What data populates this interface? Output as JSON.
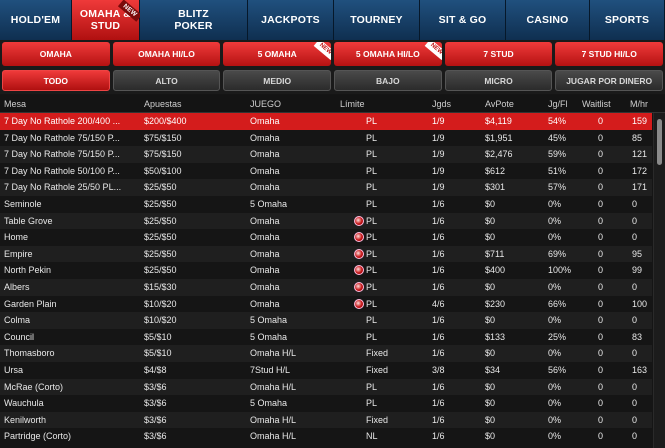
{
  "top_nav": [
    {
      "label": "HOLD'EM",
      "width": 72,
      "active": false,
      "new": false
    },
    {
      "label": "OMAHA & STUD",
      "width": 68,
      "active": true,
      "new": true
    },
    {
      "label": "BLITZ POKER",
      "width": 108,
      "active": false,
      "new": false
    },
    {
      "label": "JACKPOTS",
      "width": 86,
      "active": false,
      "new": false
    },
    {
      "label": "TOURNEY",
      "width": 86,
      "active": false,
      "new": false
    },
    {
      "label": "SIT & GO",
      "width": 86,
      "active": false,
      "new": false
    },
    {
      "label": "CASINO",
      "width": 84,
      "active": false,
      "new": false
    },
    {
      "label": "SPORTS",
      "width": 75,
      "active": false,
      "new": false
    }
  ],
  "new_badge": "NEW",
  "game_tabs": [
    {
      "label": "OMAHA",
      "new": false
    },
    {
      "label": "OMAHA HI/LO",
      "new": false
    },
    {
      "label": "5 OMAHA",
      "new": true
    },
    {
      "label": "5 OMAHA HI/LO",
      "new": true
    },
    {
      "label": "7 STUD",
      "new": false
    },
    {
      "label": "7 STUD HI/LO",
      "new": false
    }
  ],
  "filter_tabs": [
    {
      "label": "TODO",
      "active": true
    },
    {
      "label": "ALTO",
      "active": false
    },
    {
      "label": "MEDIO",
      "active": false
    },
    {
      "label": "BAJO",
      "active": false
    },
    {
      "label": "MICRO",
      "active": false
    },
    {
      "label": "JUGAR POR DINERO",
      "active": false
    }
  ],
  "columns": {
    "mesa": "Mesa",
    "apuestas": "Apuestas",
    "juego": "JUEGO",
    "limite": "Límite",
    "jgds": "Jgds",
    "avpote": "AvPote",
    "jgfl": "Jg/Fl",
    "waitlist": "Waitlist",
    "mhr": "M/hr"
  },
  "rows": [
    {
      "mesa": "7 Day No Rathole 200/400 ...",
      "apuestas": "$200/$400",
      "juego": "Omaha",
      "limite": "PL",
      "jgds": "1/9",
      "avpote": "$4,119",
      "jgfl": "54%",
      "waitlist": "0",
      "mhr": "159",
      "selected": true,
      "mark": false
    },
    {
      "mesa": "7 Day No Rathole 75/150 P...",
      "apuestas": "$75/$150",
      "juego": "Omaha",
      "limite": "PL",
      "jgds": "1/9",
      "avpote": "$1,951",
      "jgfl": "45%",
      "waitlist": "0",
      "mhr": "85",
      "selected": false,
      "mark": false
    },
    {
      "mesa": "7 Day No Rathole 75/150 P...",
      "apuestas": "$75/$150",
      "juego": "Omaha",
      "limite": "PL",
      "jgds": "1/9",
      "avpote": "$2,476",
      "jgfl": "59%",
      "waitlist": "0",
      "mhr": "121",
      "selected": false,
      "mark": false
    },
    {
      "mesa": "7 Day No Rathole 50/100 P...",
      "apuestas": "$50/$100",
      "juego": "Omaha",
      "limite": "PL",
      "jgds": "1/9",
      "avpote": "$612",
      "jgfl": "51%",
      "waitlist": "0",
      "mhr": "172",
      "selected": false,
      "mark": false
    },
    {
      "mesa": "7 Day No Rathole 25/50 PL...",
      "apuestas": "$25/$50",
      "juego": "Omaha",
      "limite": "PL",
      "jgds": "1/9",
      "avpote": "$301",
      "jgfl": "57%",
      "waitlist": "0",
      "mhr": "171",
      "selected": false,
      "mark": false
    },
    {
      "mesa": "Seminole",
      "apuestas": "$25/$50",
      "juego": "5 Omaha",
      "limite": "PL",
      "jgds": "1/6",
      "avpote": "$0",
      "jgfl": "0%",
      "waitlist": "0",
      "mhr": "0",
      "selected": false,
      "mark": false
    },
    {
      "mesa": "Table Grove",
      "apuestas": "$25/$50",
      "juego": "Omaha",
      "limite": "PL",
      "jgds": "1/6",
      "avpote": "$0",
      "jgfl": "0%",
      "waitlist": "0",
      "mhr": "0",
      "selected": false,
      "mark": true
    },
    {
      "mesa": "Home",
      "apuestas": "$25/$50",
      "juego": "Omaha",
      "limite": "PL",
      "jgds": "1/6",
      "avpote": "$0",
      "jgfl": "0%",
      "waitlist": "0",
      "mhr": "0",
      "selected": false,
      "mark": true
    },
    {
      "mesa": "Empire",
      "apuestas": "$25/$50",
      "juego": "Omaha",
      "limite": "PL",
      "jgds": "1/6",
      "avpote": "$711",
      "jgfl": "69%",
      "waitlist": "0",
      "mhr": "95",
      "selected": false,
      "mark": true
    },
    {
      "mesa": "North Pekin",
      "apuestas": "$25/$50",
      "juego": "Omaha",
      "limite": "PL",
      "jgds": "1/6",
      "avpote": "$400",
      "jgfl": "100%",
      "waitlist": "0",
      "mhr": "99",
      "selected": false,
      "mark": true
    },
    {
      "mesa": "Albers",
      "apuestas": "$15/$30",
      "juego": "Omaha",
      "limite": "PL",
      "jgds": "1/6",
      "avpote": "$0",
      "jgfl": "0%",
      "waitlist": "0",
      "mhr": "0",
      "selected": false,
      "mark": true
    },
    {
      "mesa": "Garden Plain",
      "apuestas": "$10/$20",
      "juego": "Omaha",
      "limite": "PL",
      "jgds": "4/6",
      "avpote": "$230",
      "jgfl": "66%",
      "waitlist": "0",
      "mhr": "100",
      "selected": false,
      "mark": true
    },
    {
      "mesa": "Colma",
      "apuestas": "$10/$20",
      "juego": "5 Omaha",
      "limite": "PL",
      "jgds": "1/6",
      "avpote": "$0",
      "jgfl": "0%",
      "waitlist": "0",
      "mhr": "0",
      "selected": false,
      "mark": false
    },
    {
      "mesa": "Council",
      "apuestas": "$5/$10",
      "juego": "5 Omaha",
      "limite": "PL",
      "jgds": "1/6",
      "avpote": "$133",
      "jgfl": "25%",
      "waitlist": "0",
      "mhr": "83",
      "selected": false,
      "mark": false
    },
    {
      "mesa": "Thomasboro",
      "apuestas": "$5/$10",
      "juego": "Omaha H/L",
      "limite": "Fixed",
      "jgds": "1/6",
      "avpote": "$0",
      "jgfl": "0%",
      "waitlist": "0",
      "mhr": "0",
      "selected": false,
      "mark": false
    },
    {
      "mesa": "Ursa",
      "apuestas": "$4/$8",
      "juego": "7Stud H/L",
      "limite": "Fixed",
      "jgds": "3/8",
      "avpote": "$34",
      "jgfl": "56%",
      "waitlist": "0",
      "mhr": "163",
      "selected": false,
      "mark": false
    },
    {
      "mesa": "McRae (Corto)",
      "apuestas": "$3/$6",
      "juego": "Omaha H/L",
      "limite": "PL",
      "jgds": "1/6",
      "avpote": "$0",
      "jgfl": "0%",
      "waitlist": "0",
      "mhr": "0",
      "selected": false,
      "mark": false
    },
    {
      "mesa": "Wauchula",
      "apuestas": "$3/$6",
      "juego": "5 Omaha",
      "limite": "PL",
      "jgds": "1/6",
      "avpote": "$0",
      "jgfl": "0%",
      "waitlist": "0",
      "mhr": "0",
      "selected": false,
      "mark": false
    },
    {
      "mesa": "Kenilworth",
      "apuestas": "$3/$6",
      "juego": "Omaha H/L",
      "limite": "Fixed",
      "jgds": "1/6",
      "avpote": "$0",
      "jgfl": "0%",
      "waitlist": "0",
      "mhr": "0",
      "selected": false,
      "mark": false
    },
    {
      "mesa": "Partridge (Corto)",
      "apuestas": "$3/$6",
      "juego": "Omaha H/L",
      "limite": "NL",
      "jgds": "1/6",
      "avpote": "$0",
      "jgfl": "0%",
      "waitlist": "0",
      "mhr": "0",
      "selected": false,
      "mark": false
    }
  ],
  "colors": {
    "accent_red": "#d41c1c",
    "nav_blue": "#20507e",
    "background": "#151515"
  }
}
